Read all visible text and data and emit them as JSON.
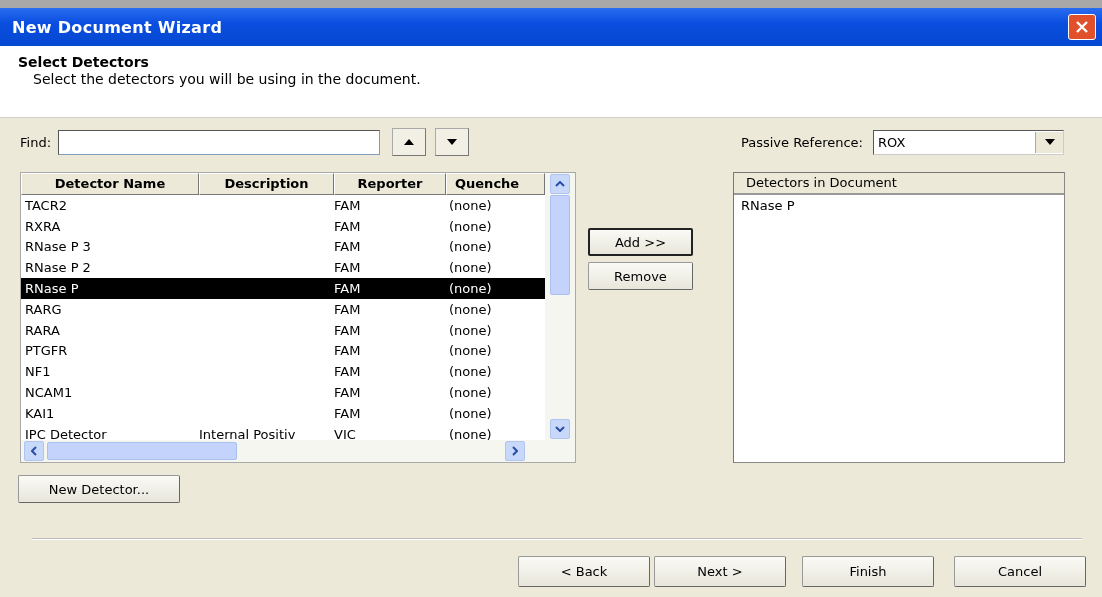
{
  "window": {
    "title": "New Document Wizard"
  },
  "header": {
    "title": "Select Detectors",
    "subtitle": "Select the detectors you will be using in the document."
  },
  "find": {
    "label": "Find:"
  },
  "passive_reference": {
    "label": "Passive Reference:",
    "value": "ROX"
  },
  "detector_table": {
    "columns": [
      "Detector Name",
      "Description",
      "Reporter",
      "Quenche"
    ],
    "rows": [
      {
        "cells": [
          "TACR2",
          "",
          "FAM",
          "(none)"
        ],
        "selected": false
      },
      {
        "cells": [
          "RXRA",
          "",
          "FAM",
          "(none)"
        ],
        "selected": false
      },
      {
        "cells": [
          "RNase P 3",
          "",
          "FAM",
          "(none)"
        ],
        "selected": false
      },
      {
        "cells": [
          "RNase P 2",
          "",
          "FAM",
          "(none)"
        ],
        "selected": false
      },
      {
        "cells": [
          "RNase P",
          "",
          "FAM",
          "(none)"
        ],
        "selected": true
      },
      {
        "cells": [
          "RARG",
          "",
          "FAM",
          "(none)"
        ],
        "selected": false
      },
      {
        "cells": [
          "RARA",
          "",
          "FAM",
          "(none)"
        ],
        "selected": false
      },
      {
        "cells": [
          "PTGFR",
          "",
          "FAM",
          "(none)"
        ],
        "selected": false
      },
      {
        "cells": [
          "NF1",
          "",
          "FAM",
          "(none)"
        ],
        "selected": false
      },
      {
        "cells": [
          "NCAM1",
          "",
          "FAM",
          "(none)"
        ],
        "selected": false
      },
      {
        "cells": [
          "KAI1",
          "",
          "FAM",
          "(none)"
        ],
        "selected": false
      },
      {
        "cells": [
          "IPC Detector",
          "Internal Positiv",
          "VIC",
          "(none)"
        ],
        "selected": false
      }
    ]
  },
  "middle_buttons": [
    {
      "label": "Add >>",
      "default": true
    },
    {
      "label": "Remove",
      "default": false
    }
  ],
  "document_list": {
    "column": "Detectors in Document",
    "items": [
      "RNase P"
    ]
  },
  "new_detector_button": "New Detector...",
  "footer_buttons": [
    "< Back",
    "Next >",
    "Finish",
    "Cancel"
  ]
}
